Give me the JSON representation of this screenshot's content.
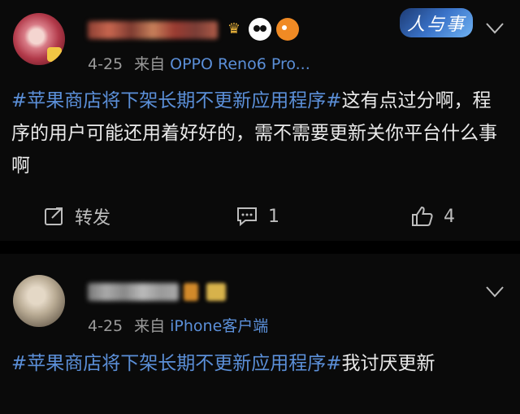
{
  "posts": [
    {
      "date": "4-25",
      "from_label": "来自",
      "device": "OPPO Reno6 Pro...",
      "hashtag": "#苹果商店将下架长期不更新应用程序#",
      "text": "这有点过分啊，程序的用户可能还用着好好的，需不需要更新关你平台什么事啊",
      "actions": {
        "repost_label": "转发",
        "comment_count": "1",
        "like_count": "4"
      },
      "logo_text": "人与事"
    },
    {
      "date": "4-25",
      "from_label": "来自",
      "device": "iPhone客户端",
      "hashtag": "#苹果商店将下架长期不更新应用程序#",
      "text": "我讨厌更新"
    }
  ],
  "colors": {
    "background": "#000000",
    "card": "#0a0a0a",
    "link": "#5b8fd8",
    "meta": "#9a9a9a",
    "text": "#eaeaea"
  },
  "icons": {
    "post1_badges": [
      "crown-icon",
      "panda-icon",
      "fish-icon"
    ],
    "expand": "chevron-down-icon",
    "repost": "repost-icon",
    "comment": "comment-icon",
    "like": "thumbs-up-icon"
  }
}
